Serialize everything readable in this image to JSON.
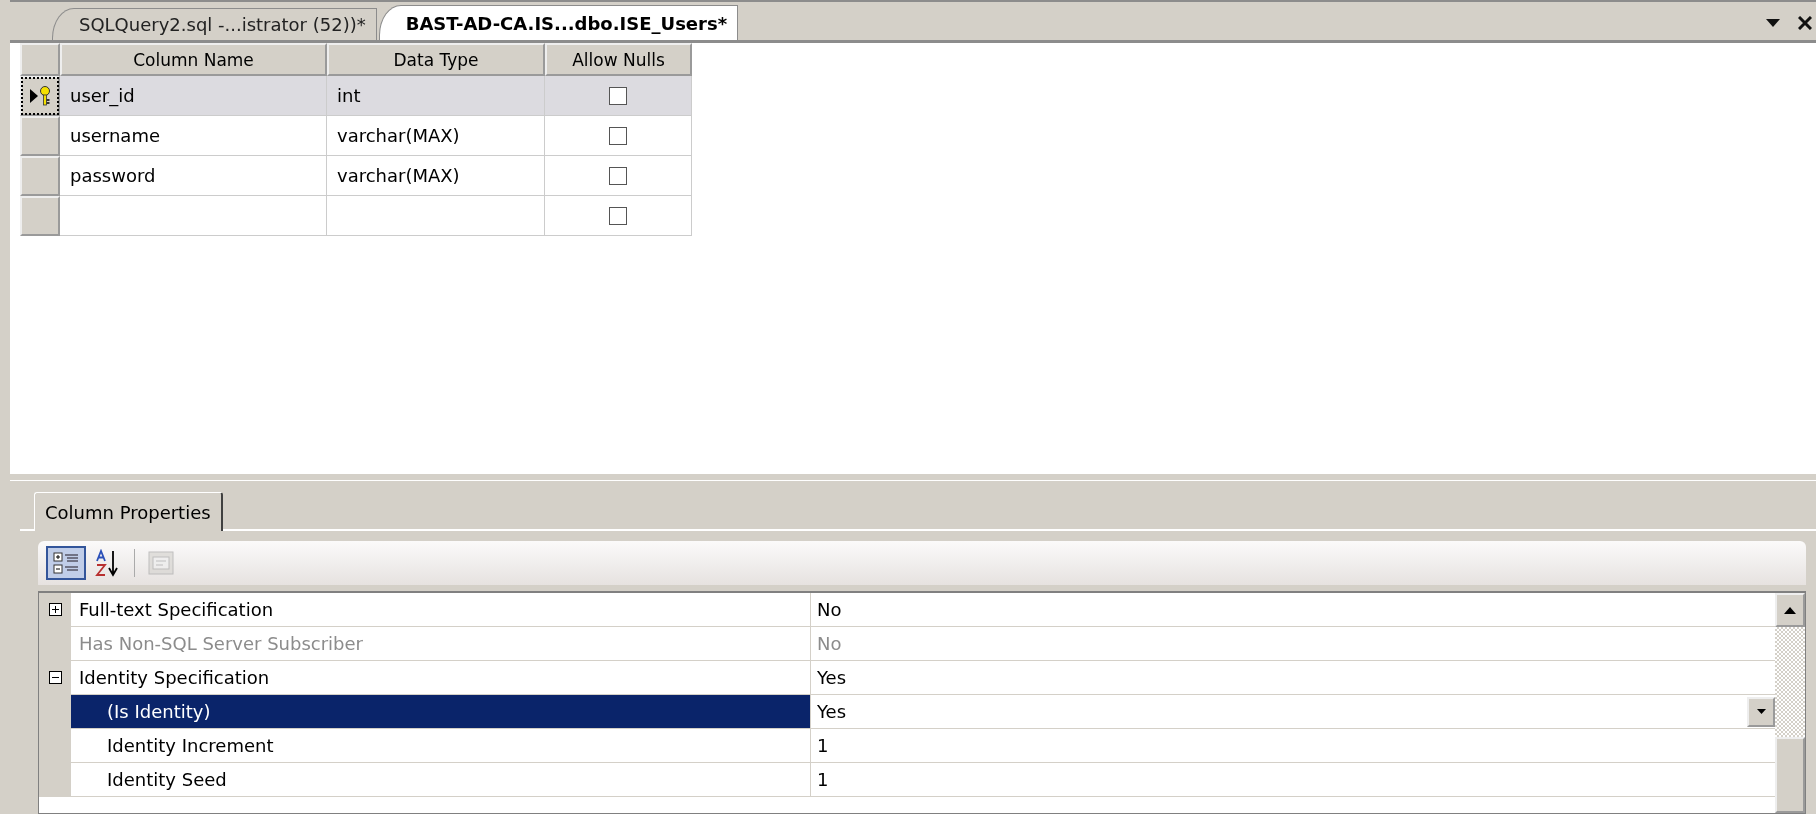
{
  "tabs": [
    {
      "label": "SQLQuery2.sql -...istrator (52))*",
      "selected": false
    },
    {
      "label": "BAST-AD-CA.IS...dbo.ISE_Users*",
      "selected": true
    }
  ],
  "table": {
    "columns": [
      "Column Name",
      "Data Type",
      "Allow Nulls"
    ],
    "rows": [
      {
        "column_name": "user_id",
        "data_type": "int",
        "allow_nulls": false,
        "primary_key": true,
        "selected": true
      },
      {
        "column_name": "username",
        "data_type": "varchar(MAX)",
        "allow_nulls": false,
        "primary_key": false,
        "selected": false
      },
      {
        "column_name": "password",
        "data_type": "varchar(MAX)",
        "allow_nulls": false,
        "primary_key": false,
        "selected": false
      },
      {
        "allow_nulls": false,
        "primary_key": false,
        "selected": false
      }
    ]
  },
  "properties_panel": {
    "tab": "Column Properties",
    "toolbar": [
      {
        "kind": "categorized",
        "selected": true,
        "disabled": false
      },
      {
        "kind": "alphabetical",
        "selected": false,
        "disabled": false
      },
      {
        "kind": "property_pages",
        "selected": false,
        "disabled": true
      }
    ],
    "properties": [
      {
        "label": "Full-text Specification",
        "value": "No",
        "expanded": false,
        "disabled": false,
        "selected": false
      },
      {
        "label": "Has Non-SQL Server Subscriber",
        "value": "No",
        "disabled": true,
        "selected": false
      },
      {
        "label": "Identity Specification",
        "value": "Yes",
        "expanded": true,
        "disabled": false,
        "selected": false,
        "children": [
          {
            "label": "(Is Identity)",
            "value": "Yes",
            "disabled": false,
            "selected": true
          },
          {
            "label": "Identity Increment",
            "value": "1",
            "disabled": false,
            "selected": false
          },
          {
            "label": "Identity Seed",
            "value": "1",
            "disabled": false,
            "selected": false
          }
        ]
      }
    ]
  }
}
